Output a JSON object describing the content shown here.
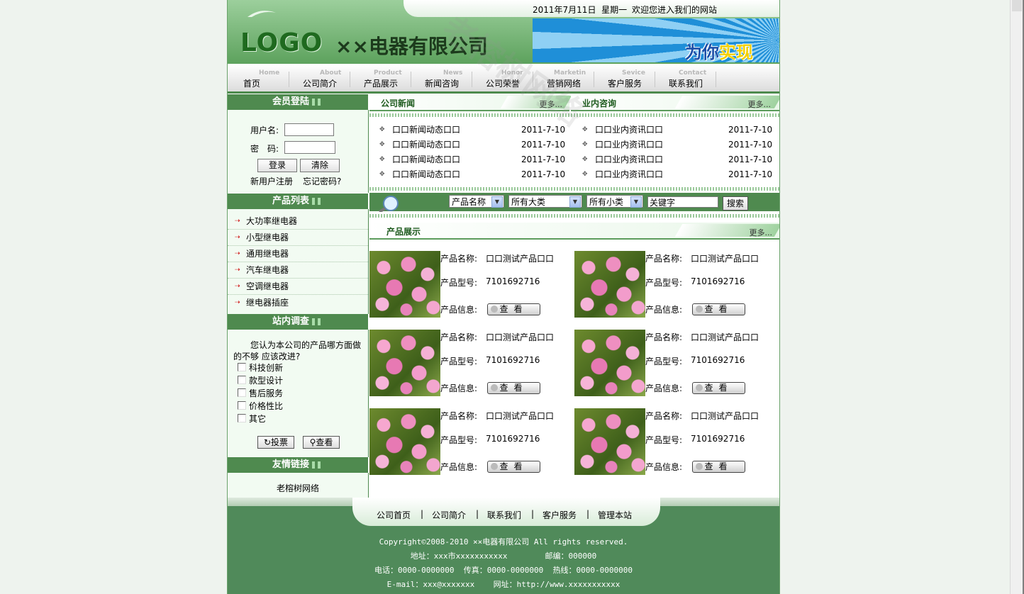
{
  "header": {
    "date": "2011年7月11日",
    "weekday": "星期一",
    "welcome": "欢迎您进入我们的网站",
    "logo": "LOGO",
    "company": "××电器有限公司",
    "slogan_a": "为你",
    "slogan_b": "实现"
  },
  "nav": [
    {
      "en": "Home",
      "cn": "首页"
    },
    {
      "en": "About",
      "cn": "公司简介"
    },
    {
      "en": "Product",
      "cn": "产品展示"
    },
    {
      "en": "News",
      "cn": "新闻咨询"
    },
    {
      "en": "Honor",
      "cn": "公司荣誉"
    },
    {
      "en": "Marketin",
      "cn": "营销网络"
    },
    {
      "en": "Sevice",
      "cn": "客户服务"
    },
    {
      "en": "Contact",
      "cn": "联系我们"
    }
  ],
  "login": {
    "title": "会员登陆",
    "username_label": "用户名:",
    "password_label": "密　码:",
    "login_button": "登录",
    "clear_button": "清除",
    "register": "新用户注册",
    "forgot": "忘记密码?"
  },
  "products_list": {
    "title": "产品列表",
    "items": [
      "大功率继电器",
      "小型继电器",
      "通用继电器",
      "汽车继电器",
      "空调继电器",
      "继电器插座"
    ]
  },
  "survey": {
    "title": "站内调查",
    "question": "您认为本公司的产品哪方面做的不够 应该改进?",
    "options": [
      "科技创新",
      "款型设计",
      "售后服务",
      "价格性比",
      "其它"
    ],
    "vote": "投票",
    "view": "查看"
  },
  "links": {
    "title": "友情链接",
    "item": "老榕树网络"
  },
  "news": {
    "title": "公司新闻",
    "more": "更多...",
    "items": [
      {
        "text": "口口新闻动态口口",
        "date": "2011-7-10"
      },
      {
        "text": "口口新闻动态口口",
        "date": "2011-7-10"
      },
      {
        "text": "口口新闻动态口口",
        "date": "2011-7-10"
      },
      {
        "text": "口口新闻动态口口",
        "date": "2011-7-10"
      }
    ]
  },
  "industry": {
    "title": "业内咨询",
    "more": "更多...",
    "items": [
      {
        "text": "口口业内资讯口口",
        "date": "2011-7-10"
      },
      {
        "text": "口口业内资讯口口",
        "date": "2011-7-10"
      },
      {
        "text": "口口业内资讯口口",
        "date": "2011-7-10"
      },
      {
        "text": "口口业内资讯口口",
        "date": "2011-7-10"
      }
    ]
  },
  "search": {
    "field": "产品名称",
    "category": "所有大类",
    "subcategory": "所有小类",
    "keyword": "关键字",
    "button": "搜索"
  },
  "showcase": {
    "title": "产品展示",
    "more": "更多...",
    "name_label": "产品名称:",
    "model_label": "产品型号:",
    "info_label": "产品信息:",
    "view_button": "查看",
    "items": [
      {
        "name": "口口测试产品口口",
        "model": "7101692716"
      },
      {
        "name": "口口测试产品口口",
        "model": "7101692716"
      },
      {
        "name": "口口测试产品口口",
        "model": "7101692716"
      },
      {
        "name": "口口测试产品口口",
        "model": "7101692716"
      },
      {
        "name": "口口测试产品口口",
        "model": "7101692716"
      },
      {
        "name": "口口测试产品口口",
        "model": "7101692716"
      }
    ]
  },
  "footer": {
    "links": [
      "公司首页",
      "公司简介",
      "联系我们",
      "客户服务",
      "管理本站"
    ],
    "copyright": "Copyright©2008-2010 ××电器有限公司 All rights reserved.",
    "address": "地址：xxx市xxxxxxxxxxx        邮编：000000",
    "phones": "电话：0000-0000000  传真：0000-0000000  热线：0000-0000000",
    "email": "E-mail：xxx@xxxxxxx    网址：http://www.xxxxxxxxxxx"
  },
  "watermark": "老榕树网络"
}
